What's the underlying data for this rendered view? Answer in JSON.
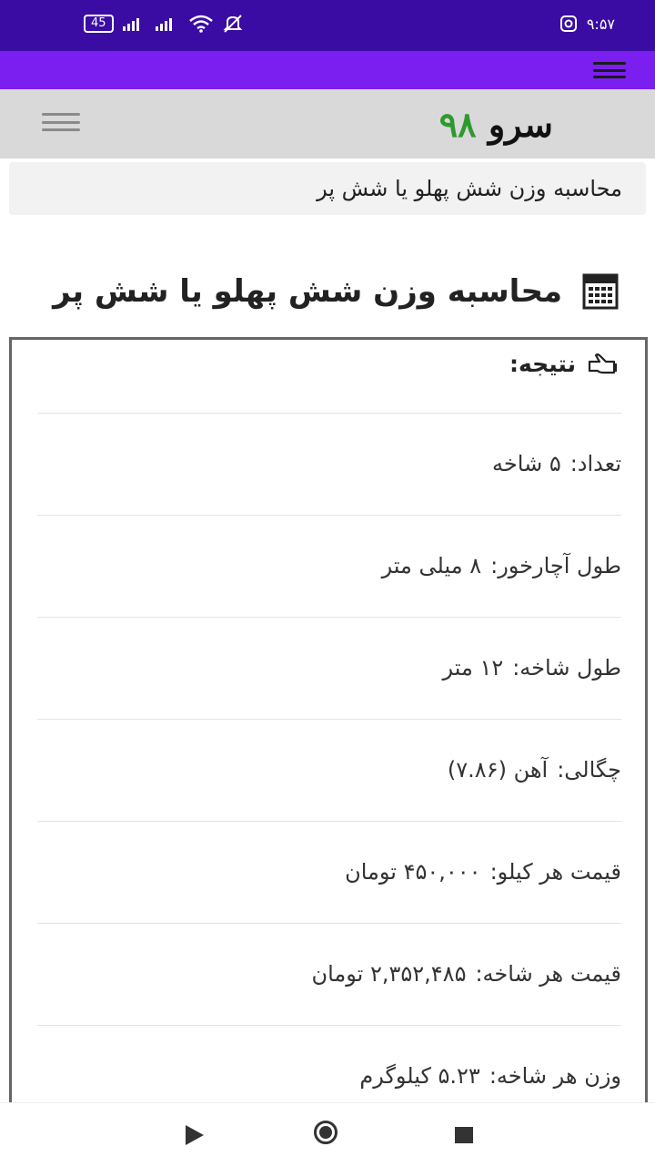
{
  "status_bar": {
    "battery": "45",
    "time": "۹:۵۷"
  },
  "header": {
    "logo_word": "سرو",
    "logo_number": "۹۸"
  },
  "breadcrumb": "محاسبه وزن شش پهلو یا شش پر",
  "page_title": "محاسبه وزن شش پهلو یا شش پر",
  "result": {
    "heading": "نتیجه:",
    "rows": [
      {
        "label": "تعداد:",
        "value": "۵ شاخه"
      },
      {
        "label": "طول آچارخور:",
        "value": "۸ میلی متر"
      },
      {
        "label": "طول شاخه:",
        "value": "۱۲ متر"
      },
      {
        "label": "چگالی:",
        "value": "آهن (۷.۸۶)"
      },
      {
        "label": "قیمت هر کیلو:",
        "value": "۴۵۰,۰۰۰ تومان"
      },
      {
        "label": "قیمت هر شاخه:",
        "value": "۲,۳۵۲,۴۸۵ تومان"
      },
      {
        "label": "وزن هر شاخه:",
        "value": "۵.۲۳ کیلوگرم"
      }
    ]
  },
  "icons": [
    "battery-icon",
    "signal-icon",
    "wifi-icon",
    "mute-icon",
    "instagram-icon",
    "menu-icon",
    "calculator-icon",
    "hand-pointer-icon",
    "back-icon",
    "home-icon",
    "recents-icon"
  ],
  "colors": {
    "status_bar": "#3a0ca3",
    "app_bar": "#7a1ff0",
    "logo_number": "#2e9a2e"
  }
}
